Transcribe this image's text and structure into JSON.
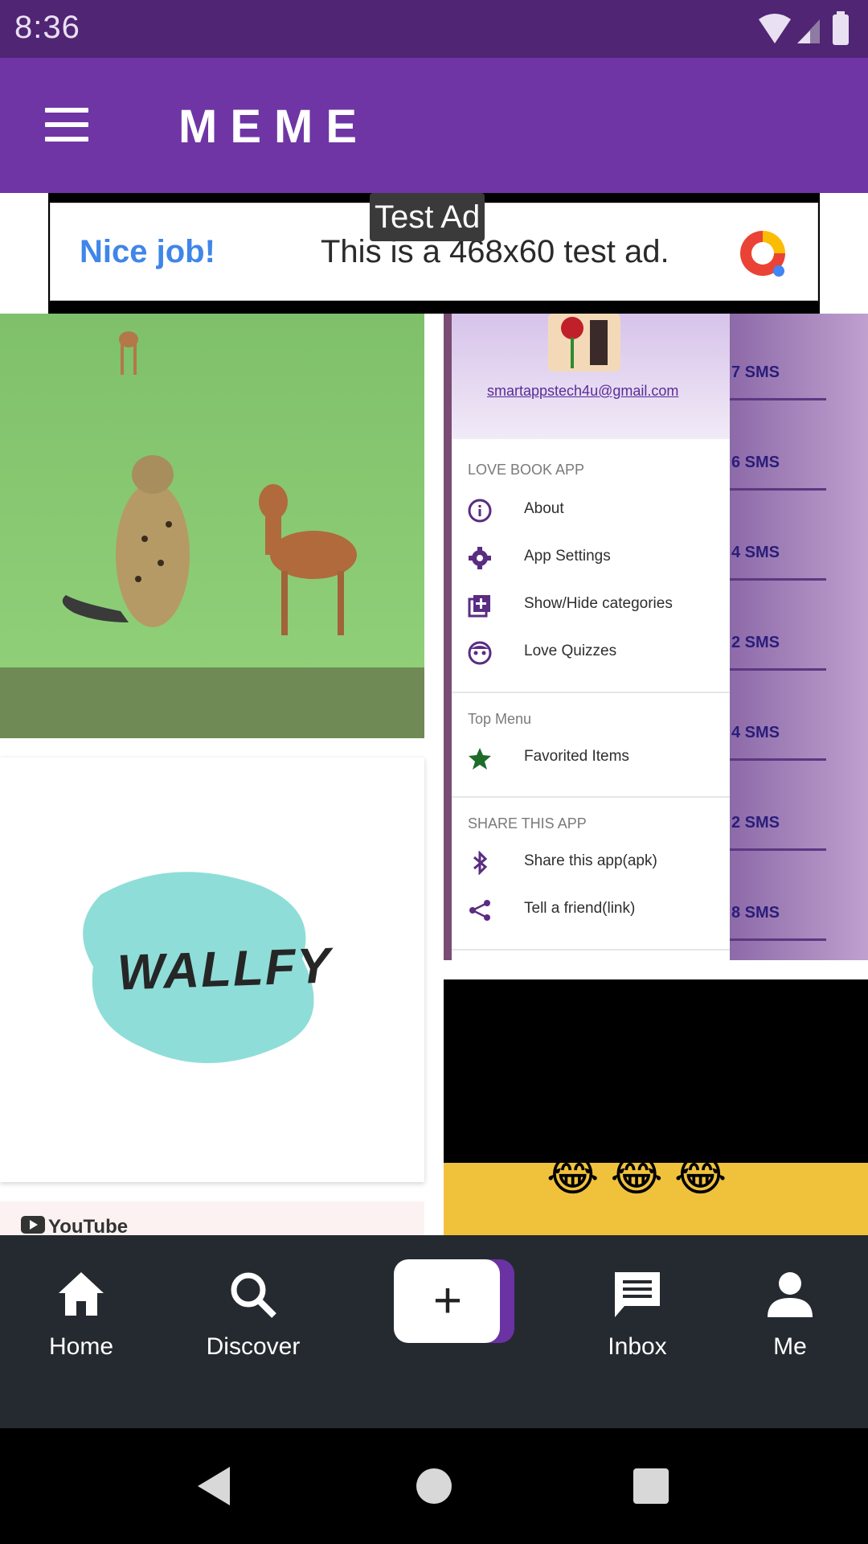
{
  "status_bar": {
    "time": "8:36"
  },
  "app_bar": {
    "title": "MEME"
  },
  "ad": {
    "label": "Test Ad",
    "headline": "Nice job!",
    "text": "This is a 468x60 test ad."
  },
  "feed": {
    "wallfy_text": "WALLFY",
    "youtube_text": "YouTube",
    "emojis": "😂😂😂",
    "drawer": {
      "email": "smartappstech4u@gmail.com",
      "sections": [
        "LOVE BOOK APP",
        "Top Menu",
        "SHARE THIS APP"
      ],
      "items": [
        {
          "label": "About",
          "icon": "info-icon"
        },
        {
          "label": "App Settings",
          "icon": "gear-icon"
        },
        {
          "label": "Show/Hide categories",
          "icon": "add-box-icon"
        },
        {
          "label": "Love Quizzes",
          "icon": "face-icon"
        },
        {
          "label": "Favorited Items",
          "icon": "star-icon"
        },
        {
          "label": "Share this app(apk)",
          "icon": "bluetooth-icon"
        },
        {
          "label": "Tell a friend(link)",
          "icon": "share-icon"
        }
      ],
      "side_labels": [
        "7 SMS",
        "6 SMS",
        "4 SMS",
        "2 SMS",
        "4 SMS",
        "2 SMS",
        "8 SMS"
      ]
    }
  },
  "bottom_nav": {
    "items": [
      {
        "label": "Home",
        "icon": "home-icon"
      },
      {
        "label": "Discover",
        "icon": "search-icon"
      },
      {
        "label": "Inbox",
        "icon": "inbox-icon"
      },
      {
        "label": "Me",
        "icon": "person-icon"
      }
    ],
    "create_label": "+"
  },
  "colors": {
    "status_bar": "#4f2574",
    "app_bar": "#6f35a5",
    "bottom_nav": "#252a30",
    "accent": "#6a32a3"
  }
}
